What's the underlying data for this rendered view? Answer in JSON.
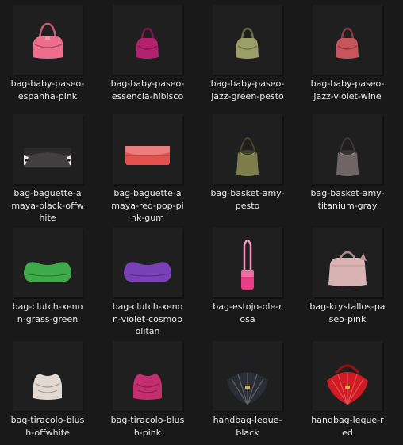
{
  "files": [
    {
      "name": "bag-baby-paseo-espanha-pink",
      "label_lines": [
        "bag-baby-paseo-",
        "espanha-pink"
      ],
      "icon": "bag-baby-paseo-pink-icon",
      "color": "#ec6d8c"
    },
    {
      "name": "bag-baby-paseo-essencia-hibisco",
      "label_lines": [
        "bag-baby-paseo-",
        "essencia-hibisco"
      ],
      "icon": "bag-baby-paseo-hibisco-icon",
      "color": "#b4226f"
    },
    {
      "name": "bag-baby-paseo-jazz-green-pesto",
      "label_lines": [
        "bag-baby-paseo-",
        "jazz-green-pesto"
      ],
      "icon": "bag-baby-paseo-pesto-icon",
      "color": "#9aa068"
    },
    {
      "name": "bag-baby-paseo-jazz-violet-wine",
      "label_lines": [
        "bag-baby-paseo-",
        "jazz-violet-wine"
      ],
      "icon": "bag-baby-paseo-wine-icon",
      "color": "#c9555c"
    },
    {
      "name": "bag-baguette-amaya-black-offwhite",
      "label_lines": [
        "bag-baguette-a",
        "maya-black-offw",
        "hite"
      ],
      "icon": "bag-baguette-black-icon",
      "color": "#2c2a2b"
    },
    {
      "name": "bag-baguette-amaya-red-pop-pink-gum",
      "label_lines": [
        "bag-baguette-a",
        "maya-red-pop-pi",
        "nk-gum"
      ],
      "icon": "bag-baguette-red-icon",
      "color": "#e5524d"
    },
    {
      "name": "bag-basket-amy-pesto",
      "label_lines": [
        "bag-basket-amy-",
        "pesto"
      ],
      "icon": "bag-basket-pesto-icon",
      "color": "#7c7d4a"
    },
    {
      "name": "bag-basket-amy-titanium-gray",
      "label_lines": [
        "bag-basket-amy-",
        "titanium-gray"
      ],
      "icon": "bag-basket-gray-icon",
      "color": "#6f6466"
    },
    {
      "name": "bag-clutch-xenon-grass-green",
      "label_lines": [
        "bag-clutch-xeno",
        "n-grass-green"
      ],
      "icon": "bag-clutch-green-icon",
      "color": "#3faa4a"
    },
    {
      "name": "bag-clutch-xenon-violet-cosmopolitan",
      "label_lines": [
        "bag-clutch-xeno",
        "n-violet-cosmop",
        "olitan"
      ],
      "icon": "bag-clutch-violet-icon",
      "color": "#7a40b8"
    },
    {
      "name": "bag-estojo-ole-rosa",
      "label_lines": [
        "bag-estojo-ole-r",
        "osa"
      ],
      "icon": "bag-estojo-rosa-icon",
      "color": "#e83c84"
    },
    {
      "name": "bag-krystallos-paseo-pink",
      "label_lines": [
        "bag-krystallos-pa",
        "seo-pink"
      ],
      "icon": "bag-krystallos-pink-icon",
      "color": "#d9b3b4"
    },
    {
      "name": "bag-tiracolo-blush-offwhite",
      "label_lines": [
        "bag-tiracolo-blus",
        "h-offwhite"
      ],
      "icon": "bag-tiracolo-offwhite-icon",
      "color": "#e2d9d2"
    },
    {
      "name": "bag-tiracolo-blush-pink",
      "label_lines": [
        "bag-tiracolo-blus",
        "h-pink"
      ],
      "icon": "bag-tiracolo-pink-icon",
      "color": "#c42e6c"
    },
    {
      "name": "handbag-leque-black",
      "label_lines": [
        "handbag-leque-",
        "black"
      ],
      "icon": "handbag-leque-black-icon",
      "color": "#2a2d33"
    },
    {
      "name": "handbag-leque-red",
      "label_lines": [
        "handbag-leque-r",
        "ed"
      ],
      "icon": "handbag-leque-red-icon",
      "color": "#d11a22"
    }
  ]
}
